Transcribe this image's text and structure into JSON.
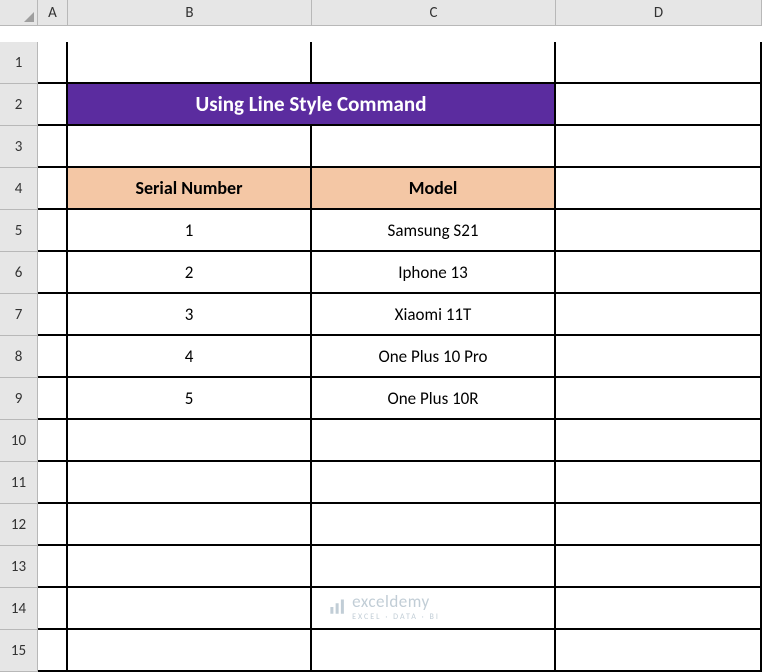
{
  "columns": [
    "A",
    "B",
    "C",
    "D"
  ],
  "row_count": 15,
  "title": "Using Line Style Command",
  "headers": {
    "serial": "Serial Number",
    "model": "Model"
  },
  "rows": [
    {
      "serial": "1",
      "model": "Samsung S21"
    },
    {
      "serial": "2",
      "model": "Iphone 13"
    },
    {
      "serial": "3",
      "model": "Xiaomi 11T"
    },
    {
      "serial": "4",
      "model": "One Plus 10 Pro"
    },
    {
      "serial": "5",
      "model": "One Plus 10R"
    }
  ],
  "watermark": {
    "brand": "exceldemy",
    "tagline": "EXCEL · DATA · BI"
  }
}
